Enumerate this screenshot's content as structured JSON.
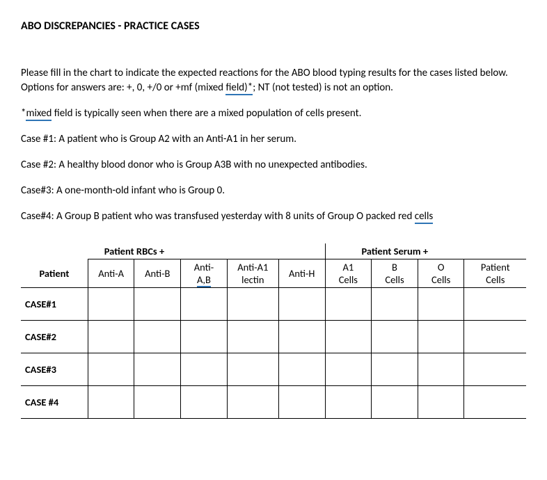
{
  "title": "ABO DISCREPANCIES - PRACTICE CASES",
  "intro_parts": {
    "p1a": "Please fill in the chart to indicate the expected reactions for the ABO blood typing results for the cases listed below. Options for answers are: +, 0, +/0 or +mf (mixed ",
    "p1_underlined": "field)*",
    "p1b": "; NT (not tested) is not an option.",
    "p2a": "*",
    "p2_underlined": "mixed",
    "p2b": " field is typically seen when there are a mixed population of cells present."
  },
  "cases": {
    "c1": "Case #1: A patient who is Group A2 with an Anti-A1 in her serum.",
    "c2": "Case #2: A healthy blood donor who is Group A3B with no unexpected antibodies.",
    "c3": "Case#3: A one-month-old infant who is Group 0.",
    "c4a": "Case#4: A Group B patient who was transfused yesterday with 8 units of Group O packed red ",
    "c4_underlined": "cells"
  },
  "table": {
    "section_headers": {
      "rbcs": "Patient RBCs +",
      "serum": "Patient Serum +"
    },
    "columns": {
      "patient": "Patient",
      "antiA": "Anti-A",
      "antiB": "Anti-B",
      "antiAB_prefix": "Anti-",
      "antiAB_underlined": "A,B",
      "antiA1_line1": "Anti-A1",
      "antiA1_line2": "lectin",
      "antiH": "Anti-H",
      "a1cells_line1": "A1",
      "a1cells_line2": "Cells",
      "bcells_line1": "B",
      "bcells_line2": "Cells",
      "ocells_line1": "O",
      "ocells_line2": "Cells",
      "patientcells_line1": "Patient",
      "patientcells_line2": "Cells"
    },
    "rows": [
      {
        "label": "CASE#1",
        "cells": [
          "",
          "",
          "",
          "",
          "",
          "",
          "",
          "",
          ""
        ]
      },
      {
        "label": "CASE#2",
        "cells": [
          "",
          "",
          "",
          "",
          "",
          "",
          "",
          "",
          ""
        ]
      },
      {
        "label": "CASE#3",
        "cells": [
          "",
          "",
          "",
          "",
          "",
          "",
          "",
          "",
          ""
        ]
      },
      {
        "label": "CASE #4",
        "cells": [
          "",
          "",
          "",
          "",
          "",
          "",
          "",
          "",
          ""
        ]
      }
    ]
  }
}
